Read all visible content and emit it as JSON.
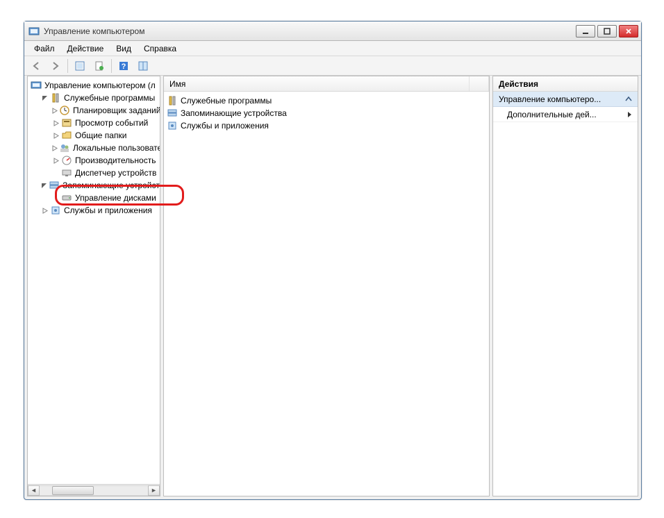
{
  "window": {
    "title": "Управление компьютером"
  },
  "menu": {
    "file": "Файл",
    "action": "Действие",
    "view": "Вид",
    "help": "Справка"
  },
  "tree": {
    "root": "Управление компьютером (л",
    "branch_utils": "Служебные программы",
    "utils": {
      "scheduler": "Планировщик заданий",
      "events": "Просмотр событий",
      "shared": "Общие папки",
      "users": "Локальные пользовате",
      "perf": "Производительность",
      "devmgr": "Диспетчер устройств"
    },
    "branch_storage": "Запоминающие устройст",
    "diskmgmt": "Управление дисками",
    "branch_services": "Службы и приложения"
  },
  "list": {
    "header_name": "Имя",
    "rows": {
      "utils": "Служебные программы",
      "storage": "Запоминающие устройства",
      "services": "Службы и приложения"
    }
  },
  "actions": {
    "header": "Действия",
    "section": "Управление компьютеро...",
    "more": "Дополнительные дей..."
  }
}
